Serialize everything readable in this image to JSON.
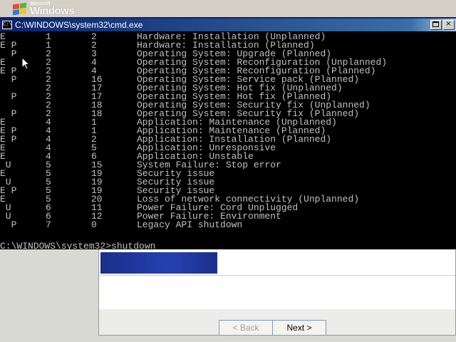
{
  "branding": {
    "microsoft": "Microsoft",
    "windows": "Windows"
  },
  "window": {
    "title": "C:\\WINDOWS\\system32\\cmd.exe"
  },
  "console": {
    "rows": [
      {
        "flags": "E",
        "major": "1",
        "minor": "2",
        "description": "Hardware: Installation (Unplanned)"
      },
      {
        "flags": "E P",
        "major": "1",
        "minor": "2",
        "description": "Hardware: Installation (Planned)"
      },
      {
        "flags": "  P",
        "major": "2",
        "minor": "3",
        "description": "Operating System: Upgrade (Planned)"
      },
      {
        "flags": "E",
        "major": "2",
        "minor": "4",
        "description": "Operating System: Reconfiguration (Unplanned)"
      },
      {
        "flags": "E P",
        "major": "2",
        "minor": "4",
        "description": "Operating System: Reconfiguration (Planned)"
      },
      {
        "flags": "  P",
        "major": "2",
        "minor": "16",
        "description": "Operating System: Service pack (Planned)"
      },
      {
        "flags": "",
        "major": "2",
        "minor": "17",
        "description": "Operating System: Hot fix (Unplanned)"
      },
      {
        "flags": "  P",
        "major": "2",
        "minor": "17",
        "description": "Operating System: Hot fix (Planned)"
      },
      {
        "flags": "",
        "major": "2",
        "minor": "18",
        "description": "Operating System: Security fix (Unplanned)"
      },
      {
        "flags": "  P",
        "major": "2",
        "minor": "18",
        "description": "Operating System: Security fix (Planned)"
      },
      {
        "flags": "E",
        "major": "4",
        "minor": "1",
        "description": "Application: Maintenance (Unplanned)"
      },
      {
        "flags": "E P",
        "major": "4",
        "minor": "1",
        "description": "Application: Maintenance (Planned)"
      },
      {
        "flags": "E P",
        "major": "4",
        "minor": "2",
        "description": "Application: Installation (Planned)"
      },
      {
        "flags": "E",
        "major": "4",
        "minor": "5",
        "description": "Application: Unresponsive"
      },
      {
        "flags": "E",
        "major": "4",
        "minor": "6",
        "description": "Application: Unstable"
      },
      {
        "flags": " U",
        "major": "5",
        "minor": "15",
        "description": "System Failure: Stop error"
      },
      {
        "flags": "E",
        "major": "5",
        "minor": "19",
        "description": "Security issue"
      },
      {
        "flags": " U",
        "major": "5",
        "minor": "19",
        "description": "Security issue"
      },
      {
        "flags": "E P",
        "major": "5",
        "minor": "19",
        "description": "Security issue"
      },
      {
        "flags": "E",
        "major": "5",
        "minor": "20",
        "description": "Loss of network connectivity (Unplanned)"
      },
      {
        "flags": " U",
        "major": "6",
        "minor": "11",
        "description": "Power Failure: Cord Unplugged"
      },
      {
        "flags": " U",
        "major": "6",
        "minor": "12",
        "description": "Power Failure: Environment"
      },
      {
        "flags": "  P",
        "major": "7",
        "minor": "0",
        "description": "Legacy API shutdown"
      }
    ],
    "prompt": "C:\\WINDOWS\\system32>shutdown"
  },
  "wizard": {
    "back_label": "< Back",
    "next_label": "Next >"
  },
  "colors": {
    "console_bg": "#000000",
    "console_fg": "#c0c0c0",
    "title_bar": "#0a246a"
  }
}
